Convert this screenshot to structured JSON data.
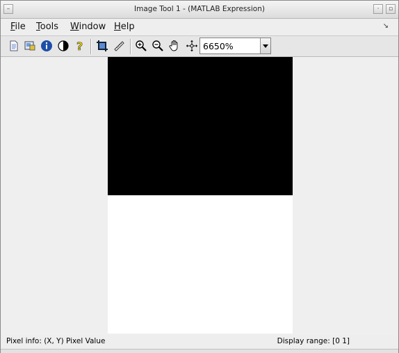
{
  "window": {
    "title": "Image Tool 1 - (MATLAB Expression)"
  },
  "menubar": {
    "items": [
      {
        "label": "File",
        "mnemonic": "F",
        "rest": "ile"
      },
      {
        "label": "Tools",
        "mnemonic": "T",
        "rest": "ools"
      },
      {
        "label": "Window",
        "mnemonic": "W",
        "rest": "indow"
      },
      {
        "label": "Help",
        "mnemonic": "H",
        "rest": "elp"
      }
    ]
  },
  "toolbar": {
    "icons": [
      "new-figure-icon",
      "export-image-icon",
      "image-info-icon",
      "adjust-contrast-icon",
      "help-icon",
      "crop-icon",
      "measure-distance-icon",
      "zoom-in-icon",
      "zoom-out-icon",
      "pan-hand-icon",
      "overview-icon"
    ],
    "zoom_value": "6650%"
  },
  "status": {
    "pixel_info": "Pixel info: (X, Y)  Pixel Value",
    "display_range": "Display range: [0 1]"
  },
  "colors": {
    "image_top": "#000000",
    "image_bottom": "#ffffff"
  }
}
